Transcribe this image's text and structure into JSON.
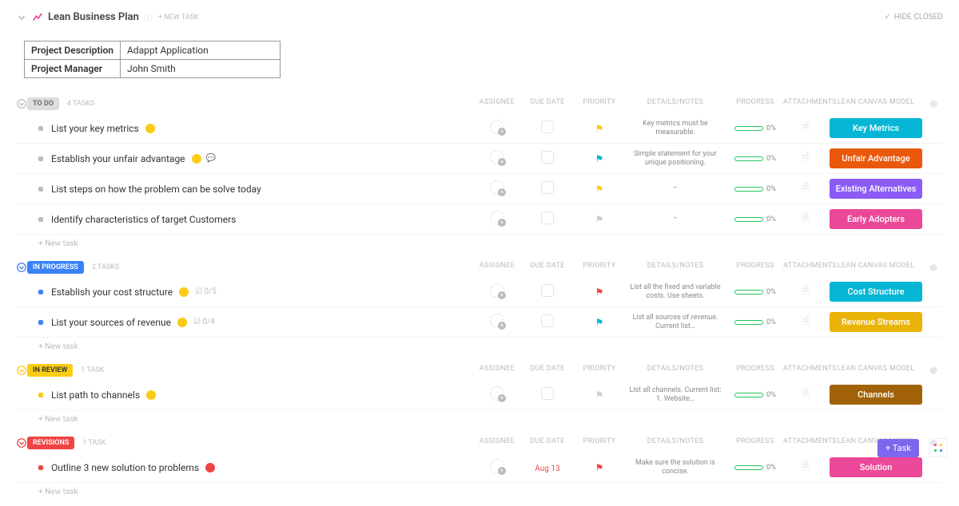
{
  "header": {
    "title": "Lean Business Plan",
    "new_task": "+ NEW TASK",
    "hide_closed": "HIDE CLOSED"
  },
  "meta": {
    "desc_label": "Project Description",
    "desc_value": "Adappt Application",
    "mgr_label": "Project Manager",
    "mgr_value": "John Smith"
  },
  "columns": {
    "assignee": "ASSIGNEE",
    "due_date": "DUE DATE",
    "priority": "PRIORITY",
    "notes": "DETAILS/NOTES",
    "progress": "PROGRESS",
    "attachments": "ATTACHMENTS",
    "lcm": "LEAN CANVAS MODEL"
  },
  "labels": {
    "new_task_row": "+ New task"
  },
  "sections": [
    {
      "id": "todo",
      "status_label": "TO DO",
      "status_class": "status-todo",
      "count_label": "4 TASKS",
      "toggle_color": "#bbb",
      "dot": "#bbb",
      "tasks": [
        {
          "title": "List your key metrics",
          "chip": "yellow",
          "sub": "",
          "comments": false,
          "flag": "yellow",
          "notes": "Key metrics must be measurable.",
          "progress": "0%",
          "tag": "Key Metrics",
          "tag_color": "#06b6d4",
          "due": ""
        },
        {
          "title": "Establish your unfair advantage",
          "chip": "yellow",
          "sub": "",
          "comments": true,
          "flag": "cyan",
          "notes": "Simple statement for your unique positioning.",
          "progress": "0%",
          "tag": "Unfair Advantage",
          "tag_color": "#ea580c",
          "due": ""
        },
        {
          "title": "List steps on how the problem can be solve today",
          "chip": "",
          "sub": "",
          "comments": false,
          "flag": "yellow",
          "notes": "–",
          "progress": "0%",
          "tag": "Existing Alternatives",
          "tag_color": "#8b5cf6",
          "due": ""
        },
        {
          "title": "Identify characteristics of target Customers",
          "chip": "",
          "sub": "",
          "comments": false,
          "flag": "grey",
          "notes": "–",
          "progress": "0%",
          "tag": "Early Adopters",
          "tag_color": "#ec4899",
          "due": ""
        }
      ]
    },
    {
      "id": "inprog",
      "status_label": "IN PROGRESS",
      "status_class": "status-inprog",
      "count_label": "2 TASKS",
      "toggle_color": "#3b82f6",
      "dot": "#3b82f6",
      "tasks": [
        {
          "title": "Establish your cost structure",
          "chip": "yellow",
          "sub": "☑ 0/5",
          "comments": false,
          "flag": "red",
          "notes": "List all the fixed and variable costs. Use sheets.",
          "progress": "0%",
          "tag": "Cost Structure",
          "tag_color": "#06b6d4",
          "due": ""
        },
        {
          "title": "List your sources of revenue",
          "chip": "yellow",
          "sub": "☑ 0/4",
          "comments": false,
          "flag": "cyan",
          "notes": "List all sources of revenue. Current list…",
          "progress": "0%",
          "tag": "Revenue Streams",
          "tag_color": "#eab308",
          "due": ""
        }
      ]
    },
    {
      "id": "inrev",
      "status_label": "IN REVIEW",
      "status_class": "status-inrev",
      "count_label": "1 TASK",
      "toggle_color": "#facc15",
      "dot": "#facc15",
      "tasks": [
        {
          "title": "List path to channels",
          "chip": "yellow",
          "sub": "",
          "comments": false,
          "flag": "grey",
          "notes": "List all channels. Current list: 1. Website…",
          "progress": "0%",
          "tag": "Channels",
          "tag_color": "#a16207",
          "due": ""
        }
      ]
    },
    {
      "id": "rev",
      "status_label": "REVISIONS",
      "status_class": "status-rev",
      "count_label": "1 TASK",
      "toggle_color": "#ef4444",
      "dot": "#ef4444",
      "tasks": [
        {
          "title": "Outline 3 new solution to problems",
          "chip": "red",
          "sub": "",
          "comments": false,
          "flag": "red",
          "notes": "Make sure the solution is concise.",
          "progress": "0%",
          "tag": "Solution",
          "tag_color": "#ec4899",
          "due": "Aug 13"
        }
      ]
    }
  ],
  "fab": {
    "label": "Task"
  }
}
